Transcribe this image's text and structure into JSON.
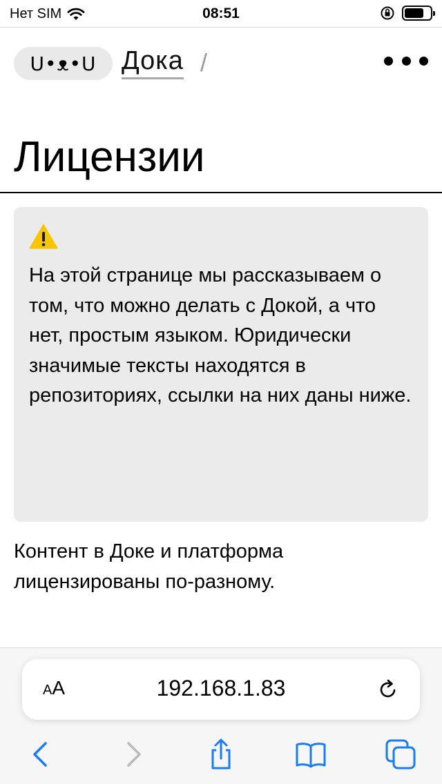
{
  "status_bar": {
    "carrier": "Нет SIM",
    "time": "08:51",
    "battery_level_percent": 75
  },
  "header": {
    "logo_text": "U•ᴥ•U",
    "breadcrumb_link": "Дока",
    "breadcrumb_separator": "/"
  },
  "page": {
    "title": "Лицензии",
    "callout_text": "На этой странице мы рассказываем о том, что можно делать с Докой, а что нет, простым языком. Юридически значимые тексты находятся в репозиториях, ссылки на них даны ниже.",
    "intro_text": "Контент в Доке и платформа лицензированы по-разному."
  },
  "browser": {
    "text_size_button": "AA",
    "url": "192.168.1.83"
  },
  "colors": {
    "accent": "#1a7cf5",
    "callout_bg": "#ebebeb",
    "warning": "#f7c600"
  }
}
